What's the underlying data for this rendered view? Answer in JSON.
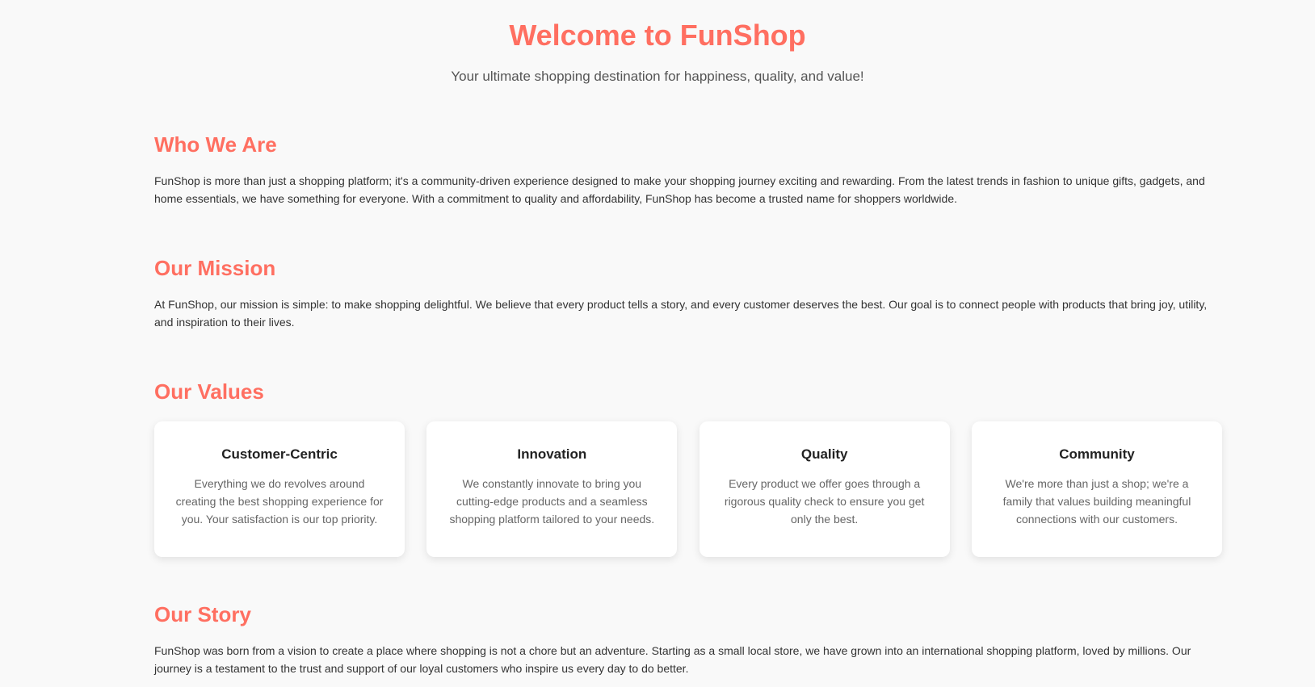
{
  "hero": {
    "title": "Welcome to FunShop",
    "subtitle": "Your ultimate shopping destination for happiness, quality, and value!"
  },
  "who_we_are": {
    "heading": "Who We Are",
    "body": "FunShop is more than just a shopping platform; it's a community-driven experience designed to make your shopping journey exciting and rewarding. From the latest trends in fashion to unique gifts, gadgets, and home essentials, we have something for everyone. With a commitment to quality and affordability, FunShop has become a trusted name for shoppers worldwide."
  },
  "mission": {
    "heading": "Our Mission",
    "body": "At FunShop, our mission is simple: to make shopping delightful. We believe that every product tells a story, and every customer deserves the best. Our goal is to connect people with products that bring joy, utility, and inspiration to their lives."
  },
  "values": {
    "heading": "Our Values",
    "cards": [
      {
        "title": "Customer-Centric",
        "body": "Everything we do revolves around creating the best shopping experience for you. Your satisfaction is our top priority."
      },
      {
        "title": "Innovation",
        "body": "We constantly innovate to bring you cutting-edge products and a seamless shopping platform tailored to your needs."
      },
      {
        "title": "Quality",
        "body": "Every product we offer goes through a rigorous quality check to ensure you get only the best."
      },
      {
        "title": "Community",
        "body": "We're more than just a shop; we're a family that values building meaningful connections with our customers."
      }
    ]
  },
  "story": {
    "heading": "Our Story",
    "body": "FunShop was born from a vision to create a place where shopping is not a chore but an adventure. Starting as a small local store, we have grown into an international shopping platform, loved by millions. Our journey is a testament to the trust and support of our loyal customers who inspire us every day to do better."
  },
  "colors": {
    "accent": "#ff6f61",
    "background": "#f9f9f9",
    "card": "#ffffff"
  }
}
